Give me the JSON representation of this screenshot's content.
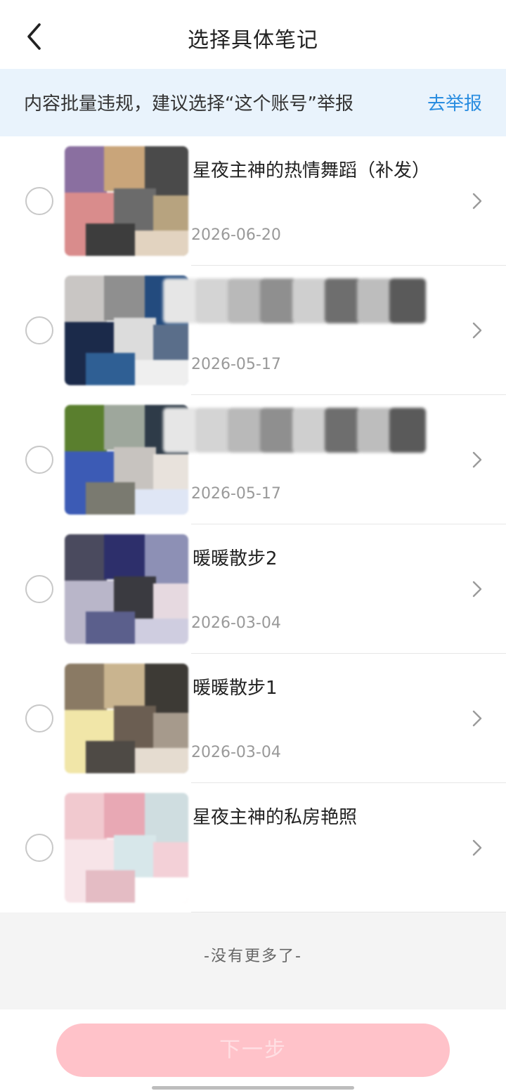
{
  "header": {
    "title": "选择具体笔记",
    "back_icon": "chevron-left-icon"
  },
  "banner": {
    "text": "内容批量违规，建议选择“这个账号”举报",
    "link": "去举报",
    "link_color": "#2a8de0",
    "background": "#e9f3fc"
  },
  "notes": [
    {
      "title": "星夜主神的热情舞蹈（补发）",
      "date": "2026-06-20",
      "title_obscured": false
    },
    {
      "title": "",
      "date": "2026-05-17",
      "title_obscured": true
    },
    {
      "title": "",
      "date": "2026-05-17",
      "title_obscured": true
    },
    {
      "title": "暖暖散步2",
      "date": "2026-03-04",
      "title_obscured": false
    },
    {
      "title": "暖暖散步1",
      "date": "2026-03-04",
      "title_obscured": false
    },
    {
      "title": "星夜主神的私房艳照",
      "date": "",
      "title_obscured": false
    }
  ],
  "footer": {
    "no_more": "-没有更多了-"
  },
  "next_button": {
    "label": "下一步",
    "background": "#ffc2c9",
    "disabled": true
  }
}
